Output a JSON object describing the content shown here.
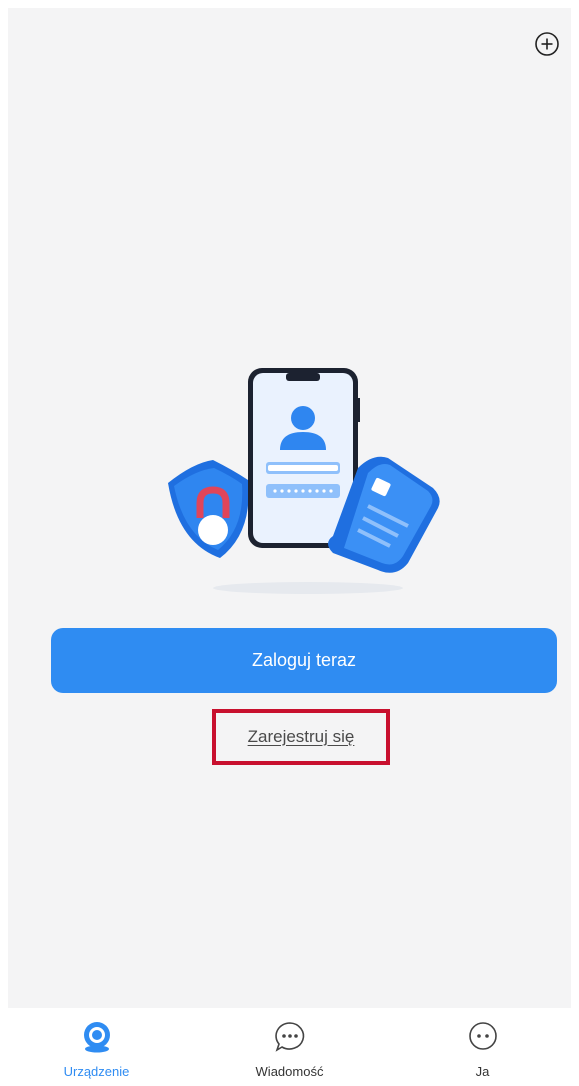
{
  "header": {
    "add_icon": "plus-circle-icon"
  },
  "illustration": {
    "icons": [
      "phone-icon",
      "user-avatar-icon",
      "shield-lock-icon",
      "document-icon"
    ]
  },
  "actions": {
    "login_label": "Zaloguj teraz",
    "register_label": "Zarejestruj się"
  },
  "tabbar": {
    "items": [
      {
        "label": "Urządzenie",
        "icon": "camera-device-icon",
        "active": true
      },
      {
        "label": "Wiadomość",
        "icon": "message-bubble-icon",
        "active": false
      },
      {
        "label": "Ja",
        "icon": "profile-bubble-icon",
        "active": false
      }
    ]
  },
  "colors": {
    "accent": "#2f8cf2",
    "highlight_box": "#c8102e",
    "background": "#f4f4f5"
  }
}
